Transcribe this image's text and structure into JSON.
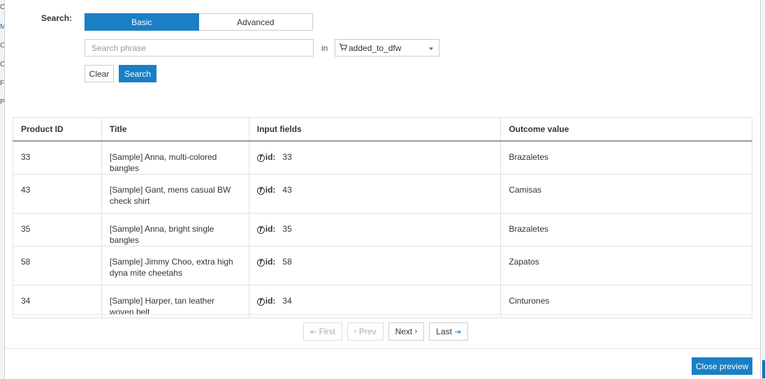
{
  "background": {
    "left_letters": [
      "C",
      "M",
      "C",
      "C",
      "F",
      "P"
    ]
  },
  "search": {
    "label": "Search:",
    "tabs": {
      "basic": "Basic",
      "advanced": "Advanced",
      "active": "Basic"
    },
    "placeholder": "Search phrase",
    "value": "",
    "in_label": "in",
    "field_select": {
      "icon": "cart-icon",
      "value": "added_to_dfw"
    },
    "clear_label": "Clear",
    "search_label": "Search"
  },
  "table": {
    "headers": [
      "Product ID",
      "Title",
      "Input fields",
      "Outcome value"
    ],
    "rows": [
      {
        "product_id": "33",
        "title": "[Sample] Anna, multi-colored bangles",
        "input_key": "id:",
        "input_value": "33",
        "outcome": "Brazaletes"
      },
      {
        "product_id": "43",
        "title": "[Sample] Gant, mens casual BW check shirt",
        "input_key": "id:",
        "input_value": "43",
        "outcome": "Camisas"
      },
      {
        "product_id": "35",
        "title": "[Sample] Anna, bright single bangles",
        "input_key": "id:",
        "input_value": "35",
        "outcome": "Brazaletes"
      },
      {
        "product_id": "58",
        "title": "[Sample] Jimmy Choo, extra high dyna mite cheetahs",
        "input_key": "id:",
        "input_value": "58",
        "outcome": "Zapatos"
      },
      {
        "product_id": "34",
        "title": "[Sample] Harper, tan leather woven belt",
        "input_key": "id:",
        "input_value": "34",
        "outcome": "Cinturones"
      }
    ]
  },
  "pagination": {
    "first": "First",
    "prev": "Prev",
    "next": "Next",
    "last": "Last"
  },
  "footer": {
    "close_preview": "Close preview"
  },
  "colors": {
    "primary": "#1a7fc4",
    "border": "#cccccc"
  }
}
